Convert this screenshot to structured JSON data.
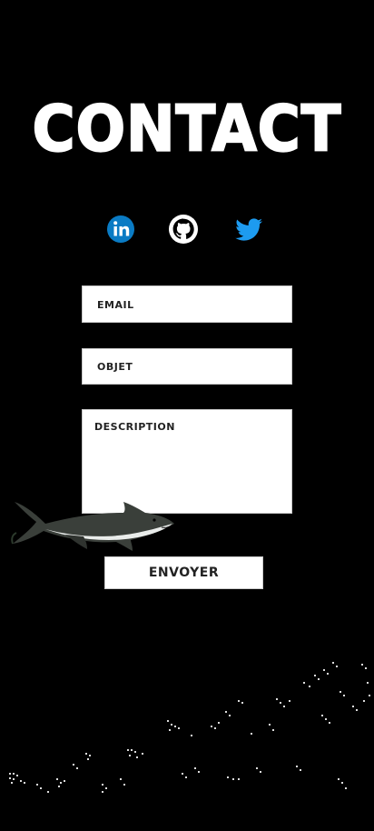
{
  "page": {
    "title": "CONTACT"
  },
  "socials": [
    {
      "name": "LinkedIn",
      "icon": "linkedin-icon",
      "color": "#0a7bc4"
    },
    {
      "name": "GitHub",
      "icon": "github-icon",
      "color": "#ffffff"
    },
    {
      "name": "Twitter",
      "icon": "twitter-icon",
      "color": "#1d9bf0"
    }
  ],
  "form": {
    "email_label": "EMAIL",
    "objet_label": "OBJET",
    "description_label": "DESCRIPTION",
    "submit_label": "ENVOYER"
  },
  "colors": {
    "background": "#000000",
    "title": "#ffffff",
    "field_bg": "#ffffff",
    "field_text": "#222222"
  },
  "decorations": {
    "shark": "shark-image",
    "city": "city-lights-image"
  }
}
